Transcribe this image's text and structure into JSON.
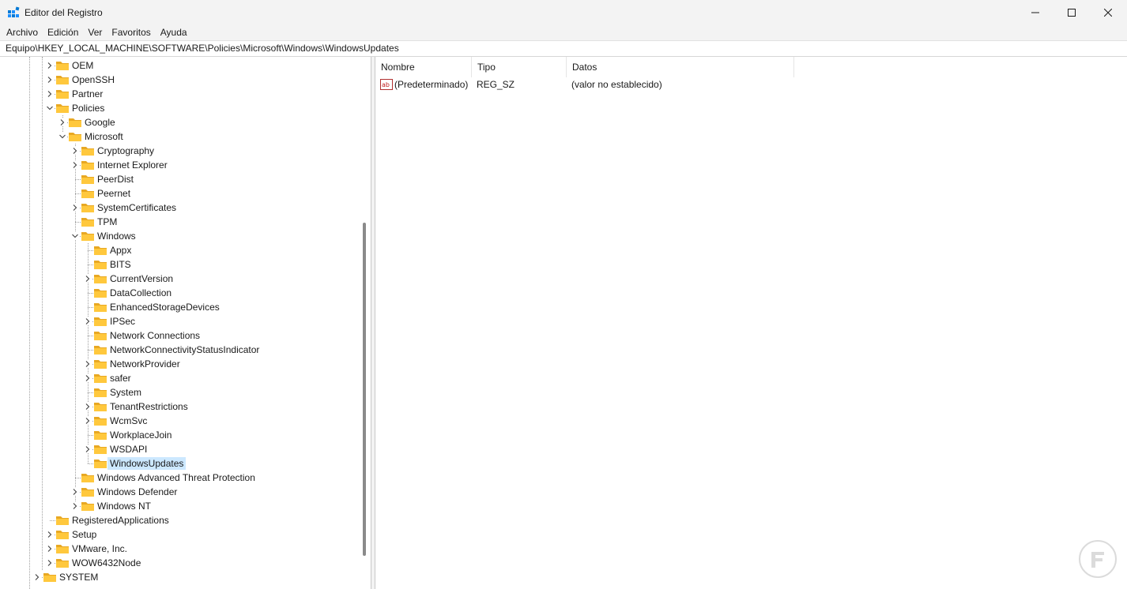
{
  "window": {
    "title": "Editor del Registro",
    "controls": {
      "minimize": "–",
      "maximize": "□",
      "close": "✕"
    }
  },
  "menu": [
    "Archivo",
    "Edición",
    "Ver",
    "Favoritos",
    "Ayuda"
  ],
  "address": "Equipo\\HKEY_LOCAL_MACHINE\\SOFTWARE\\Policies\\Microsoft\\Windows\\WindowsUpdates",
  "tree": [
    {
      "label": "OEM",
      "level": 2,
      "expander": "collapsed"
    },
    {
      "label": "OpenSSH",
      "level": 2,
      "expander": "collapsed"
    },
    {
      "label": "Partner",
      "level": 2,
      "expander": "collapsed"
    },
    {
      "label": "Policies",
      "level": 2,
      "expander": "expanded"
    },
    {
      "label": "Google",
      "level": 3,
      "expander": "collapsed"
    },
    {
      "label": "Microsoft",
      "level": 3,
      "expander": "expanded"
    },
    {
      "label": "Cryptography",
      "level": 4,
      "expander": "collapsed"
    },
    {
      "label": "Internet Explorer",
      "level": 4,
      "expander": "collapsed"
    },
    {
      "label": "PeerDist",
      "level": 4,
      "expander": "none"
    },
    {
      "label": "Peernet",
      "level": 4,
      "expander": "none"
    },
    {
      "label": "SystemCertificates",
      "level": 4,
      "expander": "collapsed"
    },
    {
      "label": "TPM",
      "level": 4,
      "expander": "none"
    },
    {
      "label": "Windows",
      "level": 4,
      "expander": "expanded"
    },
    {
      "label": "Appx",
      "level": 5,
      "expander": "none"
    },
    {
      "label": "BITS",
      "level": 5,
      "expander": "none"
    },
    {
      "label": "CurrentVersion",
      "level": 5,
      "expander": "collapsed"
    },
    {
      "label": "DataCollection",
      "level": 5,
      "expander": "none"
    },
    {
      "label": "EnhancedStorageDevices",
      "level": 5,
      "expander": "none"
    },
    {
      "label": "IPSec",
      "level": 5,
      "expander": "collapsed"
    },
    {
      "label": "Network Connections",
      "level": 5,
      "expander": "none"
    },
    {
      "label": "NetworkConnectivityStatusIndicator",
      "level": 5,
      "expander": "none"
    },
    {
      "label": "NetworkProvider",
      "level": 5,
      "expander": "collapsed"
    },
    {
      "label": "safer",
      "level": 5,
      "expander": "collapsed"
    },
    {
      "label": "System",
      "level": 5,
      "expander": "none"
    },
    {
      "label": "TenantRestrictions",
      "level": 5,
      "expander": "collapsed"
    },
    {
      "label": "WcmSvc",
      "level": 5,
      "expander": "collapsed"
    },
    {
      "label": "WorkplaceJoin",
      "level": 5,
      "expander": "none"
    },
    {
      "label": "WSDAPI",
      "level": 5,
      "expander": "collapsed"
    },
    {
      "label": "WindowsUpdates",
      "level": 5,
      "expander": "none",
      "selected": true
    },
    {
      "label": "Windows Advanced Threat Protection",
      "level": 4,
      "expander": "none"
    },
    {
      "label": "Windows Defender",
      "level": 4,
      "expander": "collapsed"
    },
    {
      "label": "Windows NT",
      "level": 4,
      "expander": "collapsed"
    },
    {
      "label": "RegisteredApplications",
      "level": 2,
      "expander": "none"
    },
    {
      "label": "Setup",
      "level": 2,
      "expander": "collapsed"
    },
    {
      "label": "VMware, Inc.",
      "level": 2,
      "expander": "collapsed"
    },
    {
      "label": "WOW6432Node",
      "level": 2,
      "expander": "collapsed"
    },
    {
      "label": "SYSTEM",
      "level": 1,
      "expander": "collapsed"
    }
  ],
  "list": {
    "columns": [
      "Nombre",
      "Tipo",
      "Datos"
    ],
    "rows": [
      {
        "icon": "string-value-icon",
        "name": "(Predeterminado)",
        "type": "REG_SZ",
        "data": "(valor no establecido)"
      }
    ]
  },
  "colors": {
    "selection": "#cce8ff",
    "folder_fill": "#ffc83d",
    "folder_tab": "#e8a823",
    "accent_icon": "#0078d4"
  }
}
